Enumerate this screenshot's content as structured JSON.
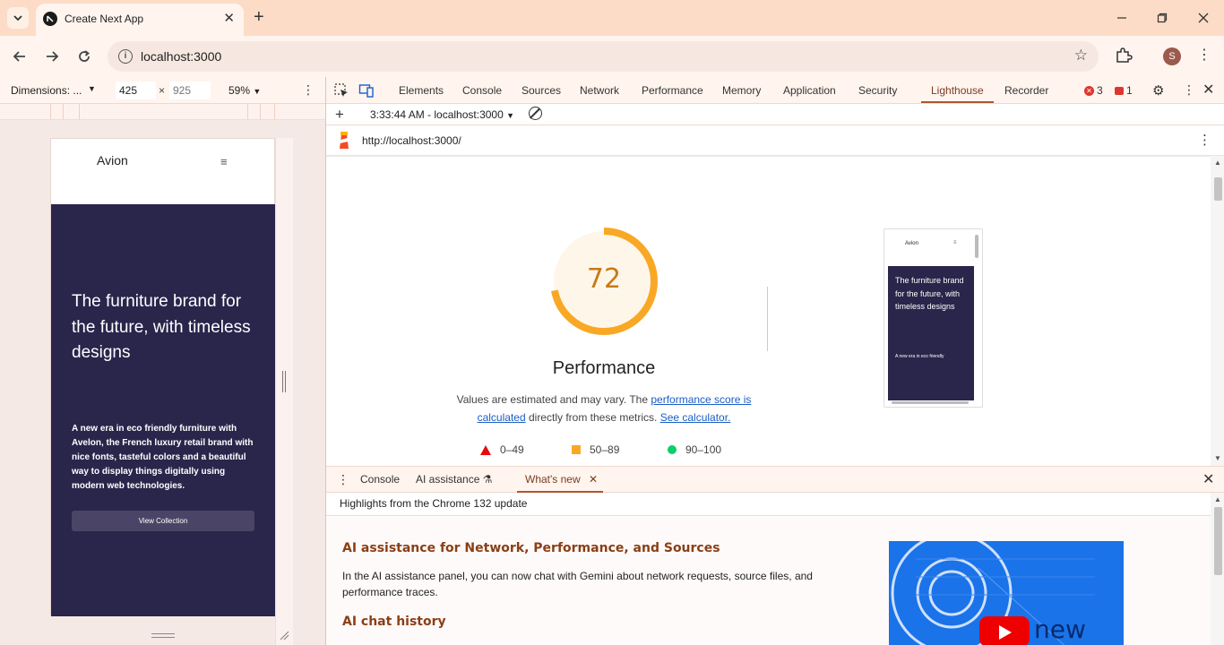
{
  "browser": {
    "tab_title": "Create Next App",
    "url": "localhost:3000",
    "profile_initial": "S"
  },
  "device_toolbar": {
    "dimensions_label": "Dimensions: ...",
    "width": "425",
    "height_placeholder": "925",
    "zoom": "59%"
  },
  "page_preview": {
    "brand": "Avion",
    "hero_heading": "The furniture brand for the future, with timeless designs",
    "hero_description": "A new era in eco friendly furniture with Avelon, the French luxury retail brand with nice fonts, tasteful colors and a beautiful way to display things digitally using modern web technologies.",
    "cta_label": "View Collection",
    "hero_color": "#2a254b"
  },
  "devtools": {
    "tabs": [
      "Elements",
      "Console",
      "Sources",
      "Network",
      "Performance",
      "Memory",
      "Application",
      "Security",
      "Lighthouse",
      "Recorder"
    ],
    "active_tab": "Lighthouse",
    "error_count": "3",
    "warning_count": "1"
  },
  "lighthouse": {
    "report_select": "3:33:44 AM - localhost:3000",
    "report_url": "http://localhost:3000/",
    "score": "72",
    "score_fraction": 0.72,
    "score_color": "#f9a825",
    "category": "Performance",
    "note_prefix": "Values are estimated and may vary. The ",
    "note_link1": "performance score is calculated",
    "note_middle": " directly from these metrics. ",
    "note_link2": "See calculator.",
    "legend": [
      {
        "range": "0–49",
        "color": "#e60b0b"
      },
      {
        "range": "50–89",
        "color": "#f9a825"
      },
      {
        "range": "90–100",
        "color": "#0cce6b"
      }
    ],
    "thumbnail": {
      "brand": "Avion",
      "heading": "The furniture brand for the future, with timeless designs",
      "sub": "A new era in eco friendly"
    }
  },
  "drawer": {
    "tabs": [
      "Console",
      "AI assistance",
      "What's new"
    ],
    "active_tab": "What's new",
    "highlights": "Highlights from the Chrome 132 update",
    "heading1": "AI assistance for Network, Performance, and Sources",
    "paragraph1": "In the AI assistance panel, you can now chat with Gemini about network requests, source files, and performance traces.",
    "heading2": "AI chat history",
    "image_word": "new"
  }
}
